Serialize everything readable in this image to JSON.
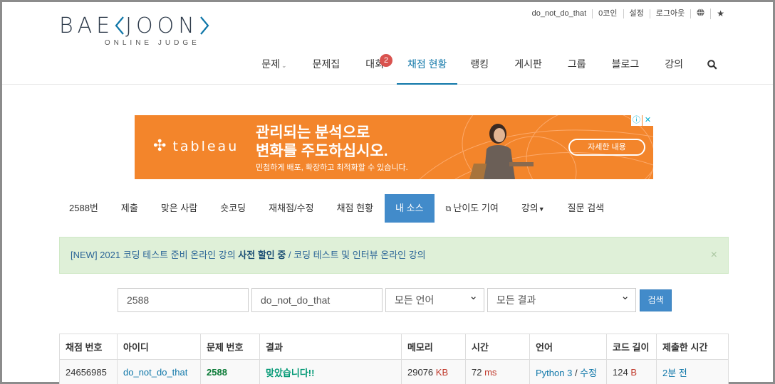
{
  "header": {
    "logo_left": "BAE",
    "logo_right": "JOON",
    "logo_sub": "ONLINE JUDGE",
    "topbar": [
      "do_not_do_that",
      "0코인",
      "설정",
      "로그아웃"
    ],
    "nav": [
      {
        "label": "문제",
        "dropdown": true
      },
      {
        "label": "문제집"
      },
      {
        "label": "대회",
        "badge": "2"
      },
      {
        "label": "채점 현황",
        "active": true
      },
      {
        "label": "랭킹"
      },
      {
        "label": "게시판"
      },
      {
        "label": "그룹"
      },
      {
        "label": "블로그"
      },
      {
        "label": "강의"
      }
    ]
  },
  "ad": {
    "brand": "tableau",
    "headline1": "관리되는 분석으로",
    "headline2": "변화를 주도하십시오.",
    "sub": "민첩하게 배포, 확장하고 최적화할 수 있습니다.",
    "cta": "자세한 내용",
    "colors": {
      "background": "#f3852b",
      "close": "#00aecd"
    }
  },
  "subnav": [
    {
      "label": "2588번"
    },
    {
      "label": "제출"
    },
    {
      "label": "맞은 사람"
    },
    {
      "label": "숏코딩"
    },
    {
      "label": "재채점/수정"
    },
    {
      "label": "채점 현황"
    },
    {
      "label": "내 소스",
      "active": true
    },
    {
      "label": "난이도 기여",
      "icon": "external-link-icon"
    },
    {
      "label": "강의",
      "dropdown": true
    },
    {
      "label": "질문 검색"
    }
  ],
  "alert": {
    "prefix": "[NEW] 2021 코딩 테스트 준비 온라인 강의 ",
    "bold": "사전 할인 중",
    "suffix": " / 코딩 테스트 및 인터뷰 온라인 강의",
    "close": "×"
  },
  "search": {
    "problem_id": "2588",
    "user_id": "do_not_do_that",
    "language": "모든 언어",
    "result": "모든 결과",
    "button": "검색"
  },
  "table": {
    "headers": [
      "채점 번호",
      "아이디",
      "문제 번호",
      "결과",
      "메모리",
      "시간",
      "언어",
      "코드 길이",
      "제출한 시간"
    ],
    "rows": [
      {
        "submission_id": "24656985",
        "user": "do_not_do_that",
        "problem": "2588",
        "result": "맞았습니다!!",
        "memory": "29076",
        "memory_unit": "KB",
        "time": "72",
        "time_unit": "ms",
        "language": "Python 3",
        "edit": "수정",
        "code_length": "124",
        "code_unit": "B",
        "submitted": "2분 전"
      }
    ]
  },
  "colors": {
    "primary": "#428bca",
    "link": "#0e76a8",
    "badge": "#d9534f",
    "alert_bg": "#dff0d8"
  }
}
